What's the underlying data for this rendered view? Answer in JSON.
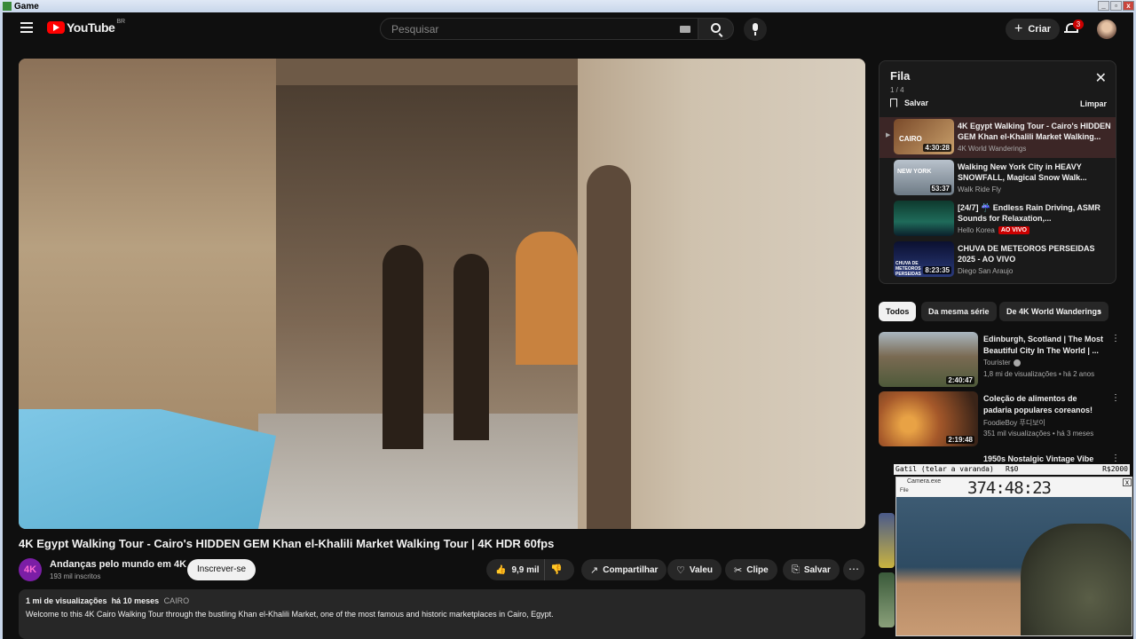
{
  "window": {
    "title": "Game"
  },
  "header": {
    "logo": "YouTube",
    "country": "BR",
    "search_placeholder": "Pesquisar",
    "create_label": "Criar",
    "notif_count": "3"
  },
  "video": {
    "title": "4K Egypt Walking Tour - Cairo's HIDDEN GEM Khan el-Khalili Market Walking Tour | 4K HDR 60fps",
    "channel": "Andanças pelo mundo em 4K",
    "channel_initials": "4K",
    "subscribers": "193 mil inscritos",
    "subscribe_label": "Inscrever-se",
    "likes": "9,9 mil",
    "share_label": "Compartilhar",
    "thanks_label": "Valeu",
    "clip_label": "Clipe",
    "save_label": "Salvar",
    "views": "1 mi de visualizações",
    "age": "há 10 meses",
    "tag": "CAIRO",
    "description": "Welcome to this 4K Cairo Walking Tour through the bustling Khan el-Khalili Market, one of the most famous and historic marketplaces in Cairo, Egypt."
  },
  "queue": {
    "title": "Fila",
    "count": "1 / 4",
    "save_label": "Salvar",
    "clear_label": "Limpar",
    "items": [
      {
        "title": "4K Egypt Walking Tour - Cairo's HIDDEN GEM Khan el-Khalili Market Walking...",
        "channel": "4K World Wanderings",
        "duration": "4:30:28",
        "thumb_text": "CAIRO",
        "active": true
      },
      {
        "title": "Walking New York City in HEAVY SNOWFALL, Magical Snow Walk...",
        "channel": "Walk Ride Fly",
        "duration": "53:37",
        "thumb_text": "NEW YORK",
        "active": false
      },
      {
        "title": "[24/7] ☔ Endless Rain Driving, ASMR Sounds for Relaxation,...",
        "channel": "Hello Korea",
        "duration": "",
        "live": "AO VIVO",
        "active": false
      },
      {
        "title": "CHUVA DE METEOROS PERSEIDAS 2025 - AO VIVO",
        "channel": "Diego San Araujo",
        "duration": "8:23:35",
        "thumb_text": "CHUVA DE METEOROS PERSEIDAS",
        "active": false
      }
    ]
  },
  "chips": [
    "Todos",
    "Da mesma série",
    "De 4K World Wanderings"
  ],
  "recommendations": [
    {
      "title": "Edinburgh, Scotland | The Most Beautiful City In The World | ...",
      "channel": "Tourister",
      "verified": true,
      "views": "1,8 mi de visualizações",
      "age": "há 2 anos",
      "duration": "2:40:47"
    },
    {
      "title": "Coleção de alimentos de padaria populares coreanos!",
      "channel": "FoodieBoy 푸디보이",
      "verified": false,
      "views": "351 mil visualizações",
      "age": "há 3 meses",
      "duration": "2:19:48"
    },
    {
      "title": "1950s Nostalgic Vintage Vibe",
      "channel": "",
      "verified": false,
      "views": "",
      "age": "",
      "duration": ""
    }
  ],
  "overlay": {
    "left": "Gatil (telar a varanda)",
    "mid": "R$0",
    "right": "R$2000",
    "cam_title": "Camera.exe",
    "cam_menu": "File",
    "timer": "374:48:23"
  }
}
